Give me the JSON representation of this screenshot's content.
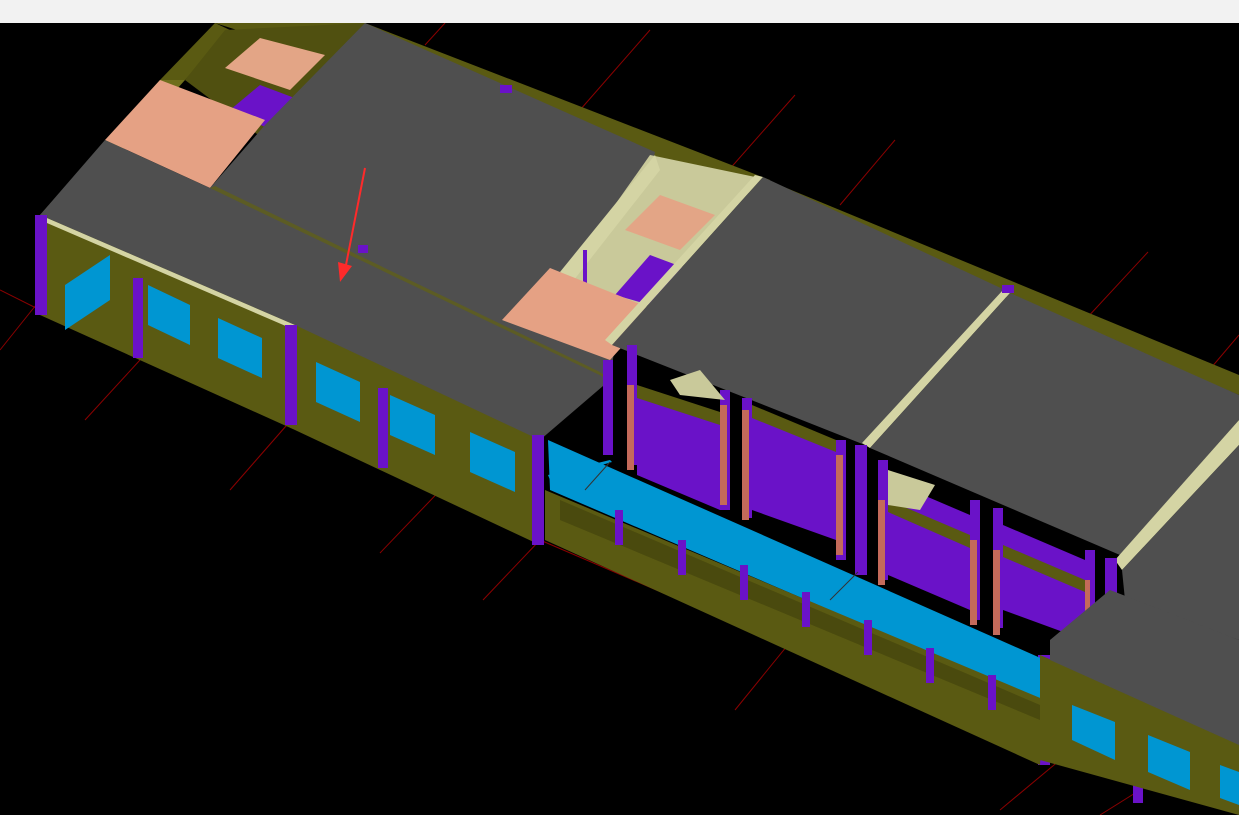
{
  "app": {
    "title_bar_text": ""
  },
  "viewport": {
    "background": "#000000",
    "grid_line_color": "#8b0000",
    "view_mode": "3D isometric",
    "annotation": "red-arrow"
  },
  "palette": {
    "slab": "#4f4f4f",
    "wall": "#5a5a12",
    "wall_light": "#6e6e1c",
    "column": "#6a12c8",
    "window": "#0096d2",
    "door_panel": "#e5a184",
    "stair_panel": "#e3a586",
    "partition": "#d4d4a4",
    "rebar": "#c46a5a"
  }
}
